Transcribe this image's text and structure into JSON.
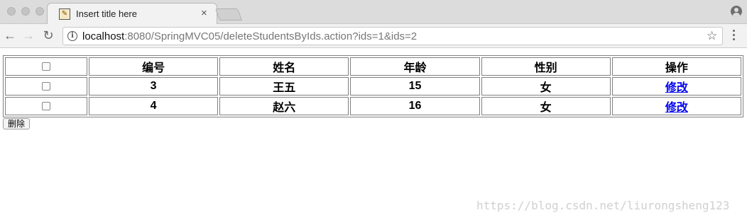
{
  "browser": {
    "tab": {
      "title": "Insert title here",
      "close": "×",
      "favicon": "page-favicon"
    },
    "url": {
      "host": "localhost",
      "rest": ":8080/SpringMVC05/deleteStudentsByIds.action?ids=1&ids=2"
    },
    "icons": {
      "back": "←",
      "forward": "→",
      "reload": "↻",
      "info": "i",
      "star": "☆"
    }
  },
  "table": {
    "headers": [
      "编号",
      "姓名",
      "年龄",
      "性别",
      "操作"
    ],
    "rows": [
      {
        "id": "3",
        "name": "王五",
        "age": "15",
        "gender": "女",
        "action": "修改"
      },
      {
        "id": "4",
        "name": "赵六",
        "age": "16",
        "gender": "女",
        "action": "修改"
      }
    ]
  },
  "delete_button": {
    "label": "删除"
  },
  "watermark": "https://blog.csdn.net/liurongsheng123"
}
